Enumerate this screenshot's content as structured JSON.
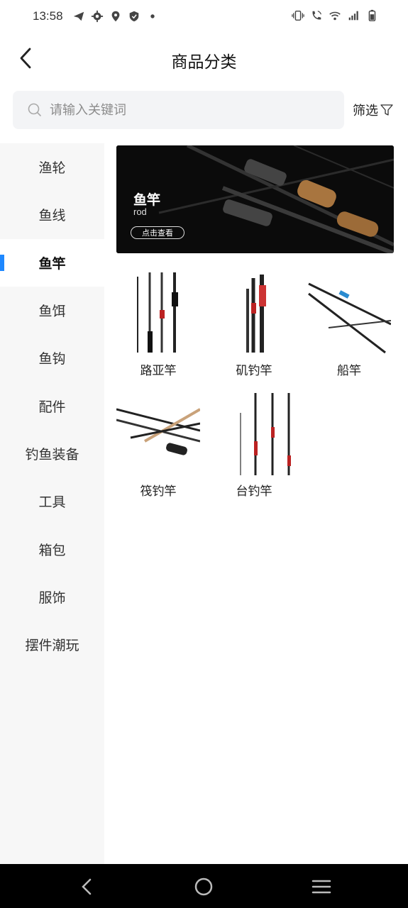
{
  "status_bar": {
    "time": "13:58",
    "left_icons": [
      "telegram-icon",
      "gear-icon",
      "location-icon",
      "shield-icon",
      "dot-icon"
    ],
    "right_icons": [
      "vibrate-icon",
      "wifi-call-icon",
      "wifi-icon",
      "signal-icon",
      "battery-icon"
    ]
  },
  "header": {
    "title": "商品分类",
    "back_icon": "back-arrow-icon"
  },
  "search": {
    "placeholder": "请输入关键词",
    "filter_label": "筛选"
  },
  "sidebar": {
    "items": [
      {
        "label": "渔轮",
        "active": false
      },
      {
        "label": "鱼线",
        "active": false
      },
      {
        "label": "鱼竿",
        "active": true
      },
      {
        "label": "鱼饵",
        "active": false
      },
      {
        "label": "鱼钩",
        "active": false
      },
      {
        "label": "配件",
        "active": false
      },
      {
        "label": "钓鱼装备",
        "active": false
      },
      {
        "label": "工具",
        "active": false
      },
      {
        "label": "箱包",
        "active": false
      },
      {
        "label": "服饰",
        "active": false
      },
      {
        "label": "摆件潮玩",
        "active": false
      }
    ]
  },
  "banner": {
    "title": "鱼竿",
    "subtitle": "rod",
    "button": "点击查看"
  },
  "subcategories": [
    {
      "label": "路亚竿"
    },
    {
      "label": "矶钓竿"
    },
    {
      "label": "船竿"
    },
    {
      "label": "筏钓竿"
    },
    {
      "label": "台钓竿"
    }
  ],
  "colors": {
    "accent": "#1e88ff",
    "sidebar_bg": "#f7f7f7",
    "search_bg": "#f3f4f6",
    "nav_bg": "#000000"
  },
  "nav": [
    "back-nav-icon",
    "home-nav-icon",
    "menu-nav-icon"
  ]
}
